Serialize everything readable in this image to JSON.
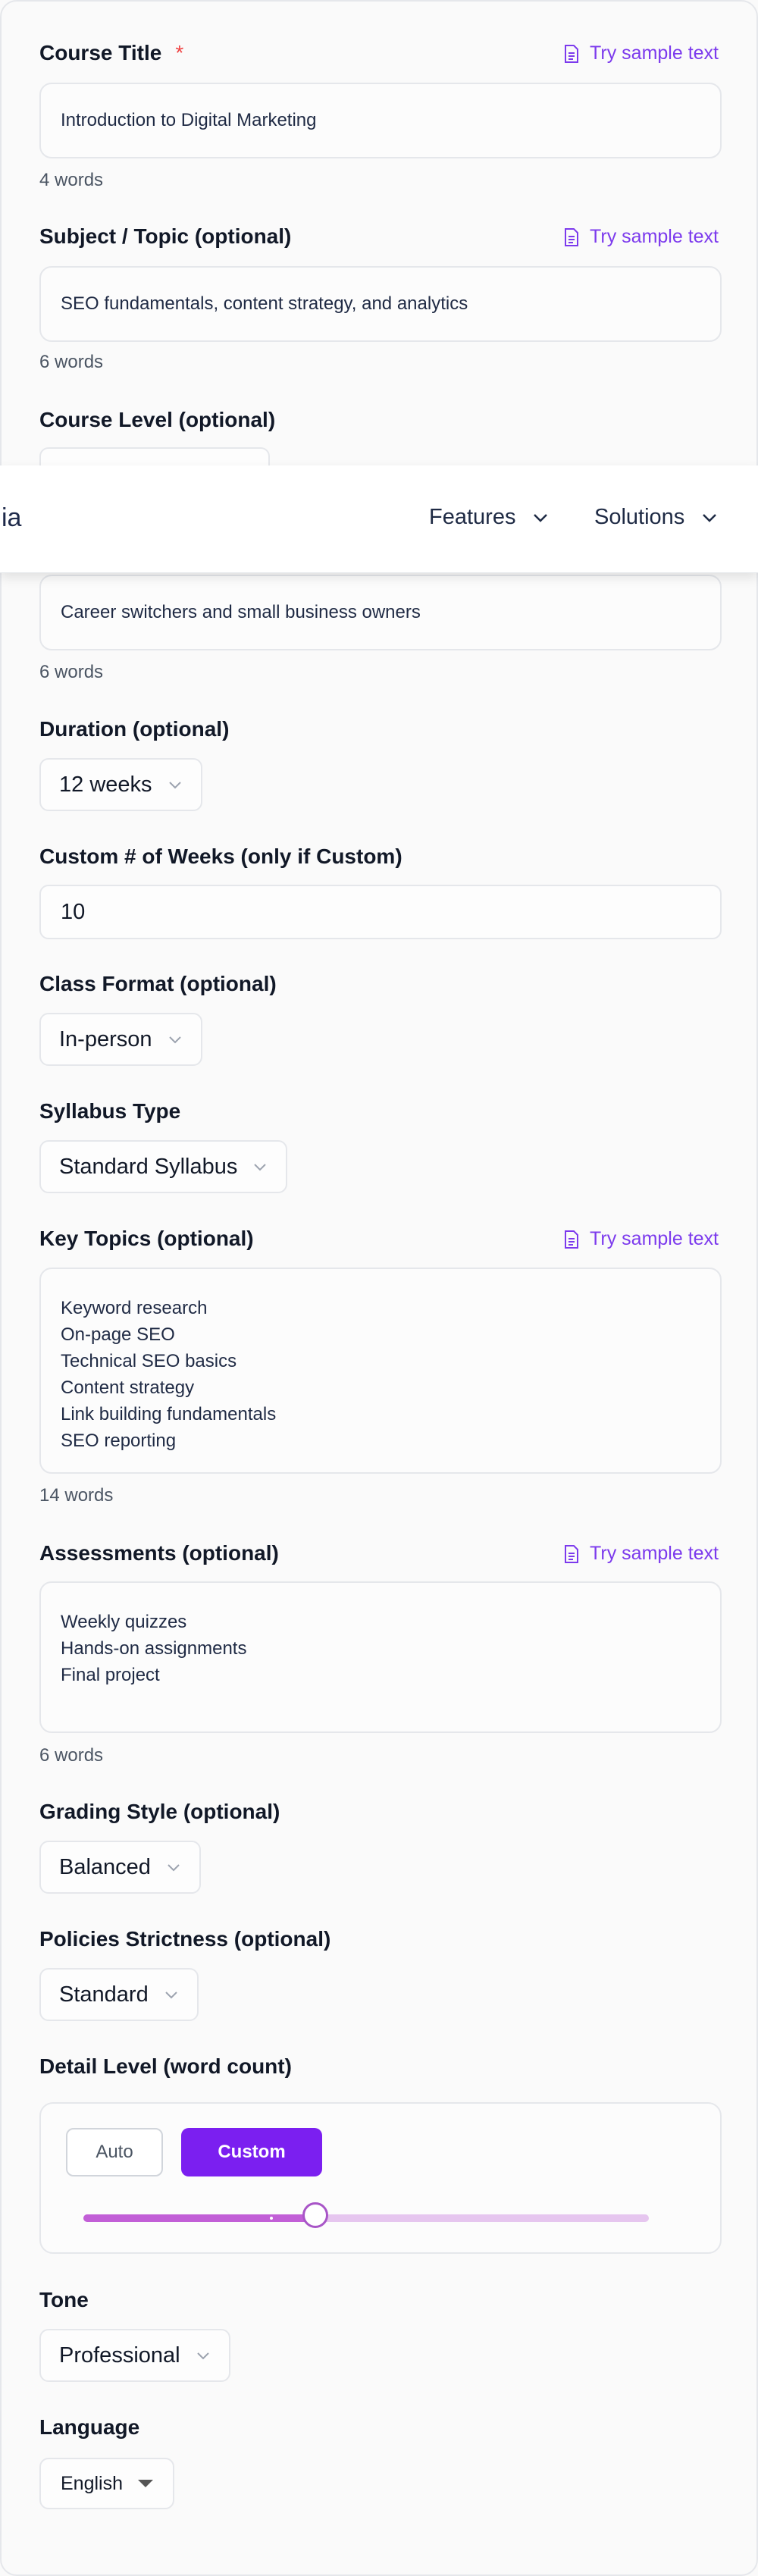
{
  "sample_label": "Try sample text",
  "course_title": {
    "label": "Course Title",
    "required_mark": "*",
    "value": "Introduction to Digital Marketing",
    "word_count": "4 words"
  },
  "subject": {
    "label": "Subject / Topic (optional)",
    "value": "SEO fundamentals, content strategy, and analytics",
    "word_count": "6 words"
  },
  "course_level": {
    "label": "Course Level (optional)"
  },
  "nav": {
    "logo_fragment": "ia",
    "menu": [
      {
        "label": "Features"
      },
      {
        "label": "Solutions"
      }
    ]
  },
  "audience": {
    "value": "Career switchers and small business owners",
    "word_count": "6 words"
  },
  "duration": {
    "label": "Duration (optional)",
    "value": "12 weeks"
  },
  "custom_weeks": {
    "label": "Custom # of Weeks (only if Custom)",
    "value": "10"
  },
  "class_format": {
    "label": "Class Format (optional)",
    "value": "In-person"
  },
  "syllabus_type": {
    "label": "Syllabus Type",
    "value": "Standard Syllabus"
  },
  "key_topics": {
    "label": "Key Topics (optional)",
    "lines": [
      "Keyword research",
      "On-page SEO",
      "Technical SEO basics",
      "Content strategy",
      "Link building fundamentals",
      "SEO reporting"
    ],
    "word_count": "14 words"
  },
  "assessments": {
    "label": "Assessments (optional)",
    "lines": [
      "Weekly quizzes",
      "Hands-on assignments",
      "Final project"
    ],
    "word_count": "6 words"
  },
  "grading_style": {
    "label": "Grading Style (optional)",
    "value": "Balanced"
  },
  "policies": {
    "label": "Policies Strictness (optional)",
    "value": "Standard"
  },
  "detail_level": {
    "label": "Detail Level (word count)",
    "auto_label": "Auto",
    "custom_label": "Custom",
    "slider_fraction": 0.41
  },
  "tone": {
    "label": "Tone",
    "value": "Professional"
  },
  "language": {
    "label": "Language",
    "value": "English"
  },
  "colors": {
    "accent": "#7b1ff0",
    "required": "#ef4444",
    "slider_fill": "#c25fd7",
    "slider_track": "#e6c6ef"
  },
  "icons": {
    "sample": "document-icon",
    "select": "chevron-down-icon",
    "language": "caret-down-icon"
  }
}
